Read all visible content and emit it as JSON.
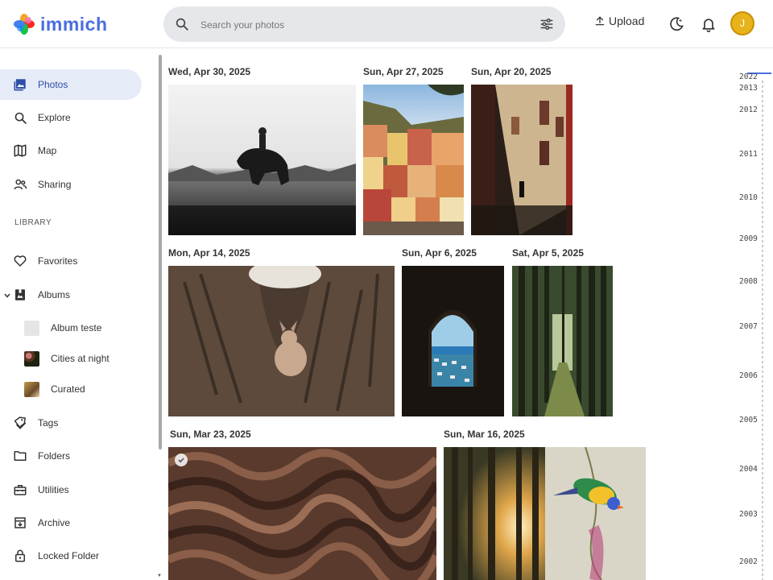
{
  "app": {
    "name": "immich"
  },
  "search": {
    "placeholder": "Search your photos"
  },
  "header": {
    "upload_label": "Upload",
    "avatar_initial": "J"
  },
  "sidebar": {
    "items": [
      {
        "label": "Photos",
        "icon": "photos-icon",
        "active": true
      },
      {
        "label": "Explore",
        "icon": "search-icon"
      },
      {
        "label": "Map",
        "icon": "map-icon"
      },
      {
        "label": "Sharing",
        "icon": "sharing-icon"
      }
    ],
    "library_label": "LIBRARY",
    "library_items": [
      {
        "label": "Favorites",
        "icon": "heart-icon"
      },
      {
        "label": "Albums",
        "icon": "albums-icon",
        "expanded": true
      }
    ],
    "albums": [
      {
        "label": "Album teste"
      },
      {
        "label": "Cities at night"
      },
      {
        "label": "Curated"
      }
    ],
    "more_items": [
      {
        "label": "Tags",
        "icon": "tag-icon"
      },
      {
        "label": "Folders",
        "icon": "folder-icon"
      },
      {
        "label": "Utilities",
        "icon": "toolbox-icon"
      },
      {
        "label": "Archive",
        "icon": "archive-icon"
      },
      {
        "label": "Locked Folder",
        "icon": "lock-icon"
      }
    ]
  },
  "groups": [
    {
      "date": "Wed, Apr 30, 2025"
    },
    {
      "date": "Sun, Apr 27, 2025"
    },
    {
      "date": "Sun, Apr 20, 2025"
    },
    {
      "date": "Mon, Apr 14, 2025"
    },
    {
      "date": "Sun, Apr 6, 2025"
    },
    {
      "date": "Sat, Apr 5, 2025"
    },
    {
      "date": "Sun, Mar 23, 2025"
    },
    {
      "date": "Sun, Mar 16, 2025"
    }
  ],
  "timeline": {
    "years": [
      "2022",
      "2013",
      "2012",
      "2011",
      "2010",
      "2009",
      "2008",
      "2007",
      "2006",
      "2005",
      "2004",
      "2003",
      "2002"
    ]
  },
  "colors": {
    "accent": "#4a6ee0",
    "active_bg": "#e6ebf8",
    "avatar": "#e8b21b"
  }
}
